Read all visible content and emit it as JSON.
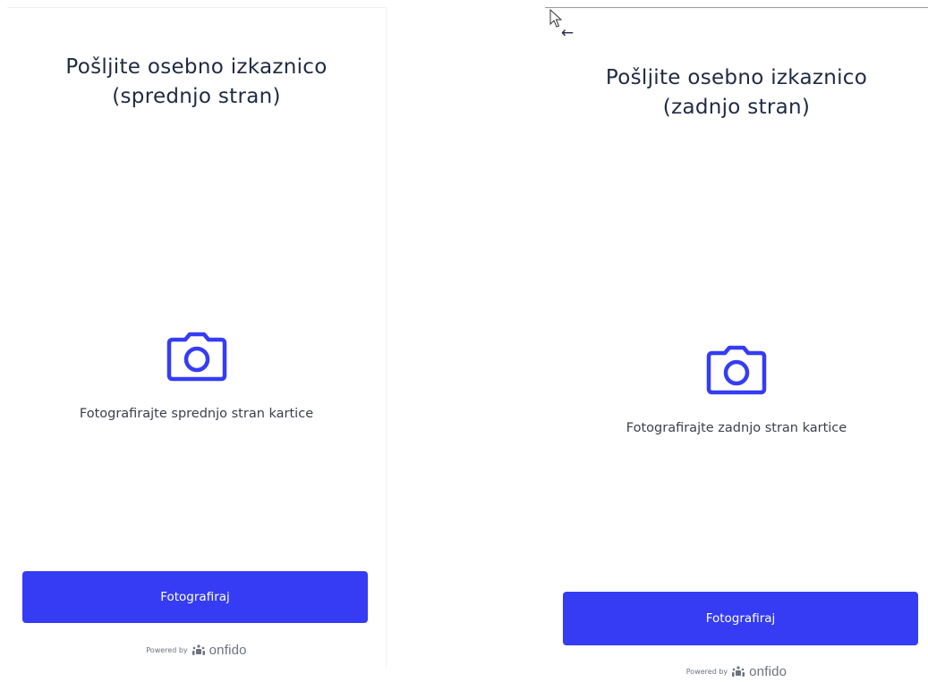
{
  "front": {
    "title_line1": "Pošljite osebno izkaznico",
    "title_line2": "(sprednjo stran)",
    "camera_icon": "camera-icon",
    "instruction": "Fotografirajte sprednjo stran kartice",
    "button_label": "Fotografiraj",
    "powered_by": "Powered by",
    "brand": "onfido"
  },
  "back": {
    "back_arrow": "←",
    "title_line1": "Pošljite osebno izkaznico",
    "title_line2": "(zadnjo stran)",
    "camera_icon": "camera-icon",
    "instruction": "Fotografirajte zadnjo stran kartice",
    "button_label": "Fotografiraj",
    "powered_by": "Powered by",
    "brand": "onfido"
  },
  "colors": {
    "accent": "#353cf4",
    "text": "#1f2a44",
    "muted": "#6b7280"
  }
}
